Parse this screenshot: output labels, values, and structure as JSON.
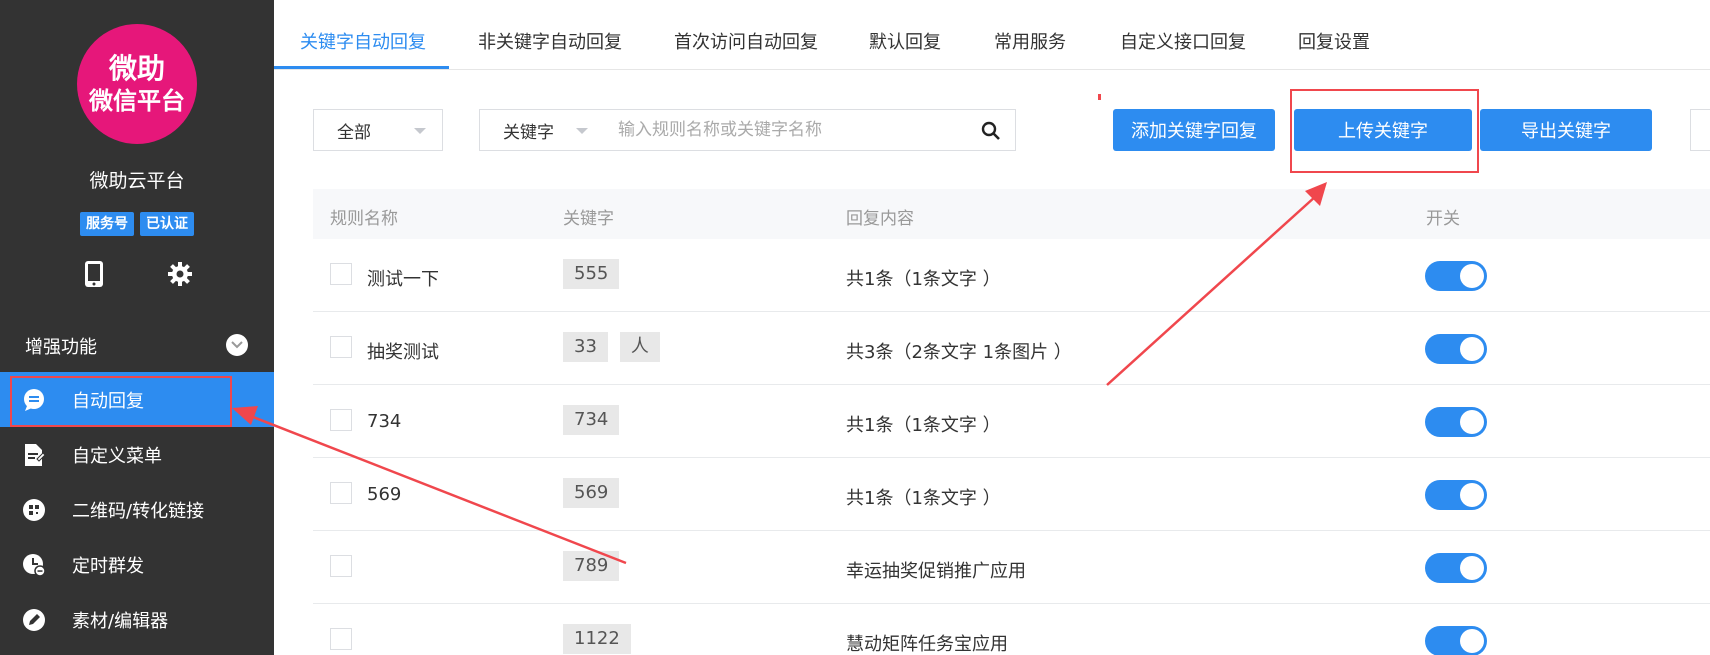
{
  "sidebar": {
    "logo": {
      "line1": "微助",
      "line2": "微信平台"
    },
    "brand_name": "微助云平台",
    "badges": [
      "服务号",
      "已认证"
    ],
    "icons": [
      "phone-icon",
      "gear-icon"
    ],
    "section_title": "增强功能",
    "items": [
      {
        "label": "自动回复",
        "icon": "chat-bubble-icon",
        "active": true
      },
      {
        "label": "自定义菜单",
        "icon": "document-edit-icon"
      },
      {
        "label": "二维码/转化链接",
        "icon": "qrcode-icon"
      },
      {
        "label": "定时群发",
        "icon": "clock-icon"
      },
      {
        "label": "素材/编辑器",
        "icon": "pencil-icon"
      }
    ]
  },
  "tabs": [
    {
      "label": "关键字自动回复",
      "active": true
    },
    {
      "label": "非关键字自动回复"
    },
    {
      "label": "首次访问自动回复"
    },
    {
      "label": "默认回复"
    },
    {
      "label": "常用服务"
    },
    {
      "label": "自定义接口回复"
    },
    {
      "label": "回复设置"
    }
  ],
  "toolbar": {
    "filter_select": "全部",
    "search_type_select": "关键字",
    "search_placeholder": "输入规则名称或关键字名称",
    "buttons": {
      "add": "添加关键字回复",
      "upload": "上传关键字",
      "export": "导出关键字"
    }
  },
  "table": {
    "headers": {
      "name": "规则名称",
      "keyword": "关键字",
      "reply": "回复内容",
      "switch": "开关"
    },
    "rows": [
      {
        "name": "测试一下",
        "keywords": [
          "555"
        ],
        "reply": "共1条（1条文字 ）",
        "enabled": true
      },
      {
        "name": "抽奖测试",
        "keywords": [
          "33",
          "人"
        ],
        "reply": "共3条（2条文字 1条图片 ）",
        "enabled": true
      },
      {
        "name": "734",
        "keywords": [
          "734"
        ],
        "reply": "共1条（1条文字 ）",
        "enabled": true
      },
      {
        "name": "569",
        "keywords": [
          "569"
        ],
        "reply": "共1条（1条文字 ）",
        "enabled": true
      },
      {
        "name": "",
        "keywords": [
          "789"
        ],
        "reply": "幸运抽奖促销推广应用",
        "enabled": true
      },
      {
        "name": "",
        "keywords": [
          "1122"
        ],
        "reply": "慧动矩阵任务宝应用",
        "enabled": true
      }
    ]
  },
  "colors": {
    "primary": "#2d8cf0",
    "sidebar_bg": "#333333",
    "logo": "#e6177a",
    "annotation": "#f0474d"
  }
}
